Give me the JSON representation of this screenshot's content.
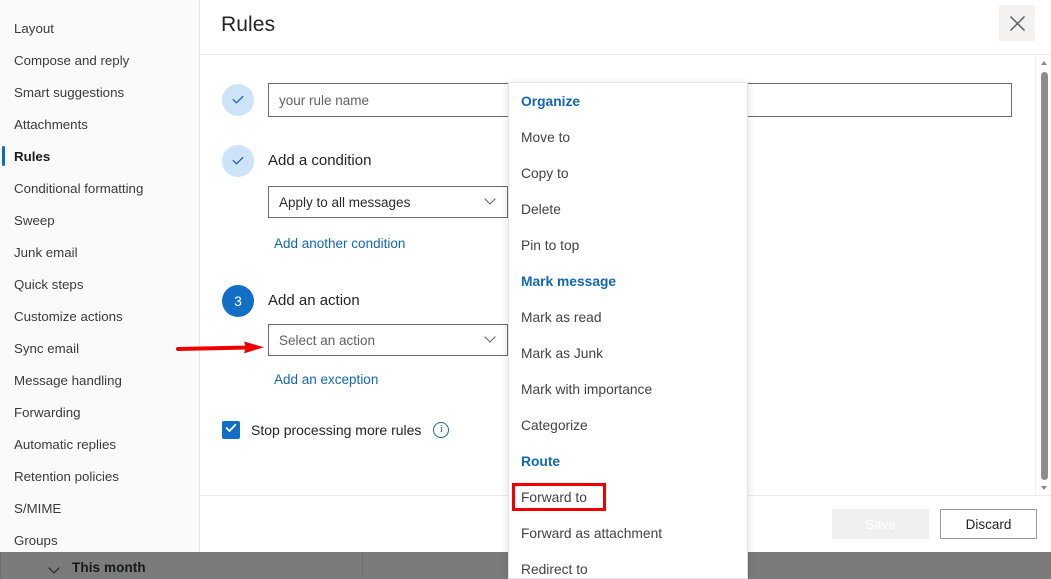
{
  "sidebar": {
    "items": [
      {
        "label": "Layout",
        "selected": false
      },
      {
        "label": "Compose and reply",
        "selected": false
      },
      {
        "label": "Smart suggestions",
        "selected": false
      },
      {
        "label": "Attachments",
        "selected": false
      },
      {
        "label": "Rules",
        "selected": true
      },
      {
        "label": "Conditional formatting",
        "selected": false
      },
      {
        "label": "Sweep",
        "selected": false
      },
      {
        "label": "Junk email",
        "selected": false
      },
      {
        "label": "Quick steps",
        "selected": false
      },
      {
        "label": "Customize actions",
        "selected": false
      },
      {
        "label": "Sync email",
        "selected": false
      },
      {
        "label": "Message handling",
        "selected": false
      },
      {
        "label": "Forwarding",
        "selected": false
      },
      {
        "label": "Automatic replies",
        "selected": false
      },
      {
        "label": "Retention policies",
        "selected": false
      },
      {
        "label": "S/MIME",
        "selected": false
      },
      {
        "label": "Groups",
        "selected": false
      }
    ]
  },
  "dialog": {
    "title": "Rules",
    "close_label": "Close",
    "steps": {
      "step1": {
        "state": "done"
      },
      "step2": {
        "state": "done",
        "label": "Add a condition"
      },
      "step3": {
        "state": "active",
        "number": "3",
        "label": "Add an action"
      }
    },
    "rule_name": {
      "value": "",
      "placeholder": "your rule name"
    },
    "condition": {
      "value": "Apply to all messages",
      "add_another_label": "Add another condition"
    },
    "action": {
      "placeholder": "Select an action",
      "add_exception_label": "Add an exception"
    },
    "stop_processing": {
      "label": "Stop processing more rules",
      "checked": true,
      "info_glyph": "i"
    },
    "footer": {
      "save_label": "Save",
      "save_disabled": true,
      "discard_label": "Discard"
    }
  },
  "action_menu": {
    "items": [
      {
        "label": "Organize",
        "type": "group"
      },
      {
        "label": "Move to",
        "type": "item"
      },
      {
        "label": "Copy to",
        "type": "item"
      },
      {
        "label": "Delete",
        "type": "item"
      },
      {
        "label": "Pin to top",
        "type": "item"
      },
      {
        "label": "Mark message",
        "type": "group"
      },
      {
        "label": "Mark as read",
        "type": "item"
      },
      {
        "label": "Mark as Junk",
        "type": "item"
      },
      {
        "label": "Mark with importance",
        "type": "item"
      },
      {
        "label": "Categorize",
        "type": "item"
      },
      {
        "label": "Route",
        "type": "group"
      },
      {
        "label": "Forward to",
        "type": "item",
        "highlighted": true
      },
      {
        "label": "Forward as attachment",
        "type": "item"
      },
      {
        "label": "Redirect to",
        "type": "item"
      }
    ]
  },
  "background": {
    "group_label": "This month"
  },
  "annotations": {
    "arrow_color": "#ef0000",
    "box_color": "#ef0000",
    "highlighted_item": "Forward to",
    "pointed_field": "Select an action"
  },
  "colors": {
    "accent": "#1170c5",
    "link": "#1267b4",
    "step_done_bg": "#cde3f7",
    "disabled_button_bg": "#f0f0f0"
  }
}
